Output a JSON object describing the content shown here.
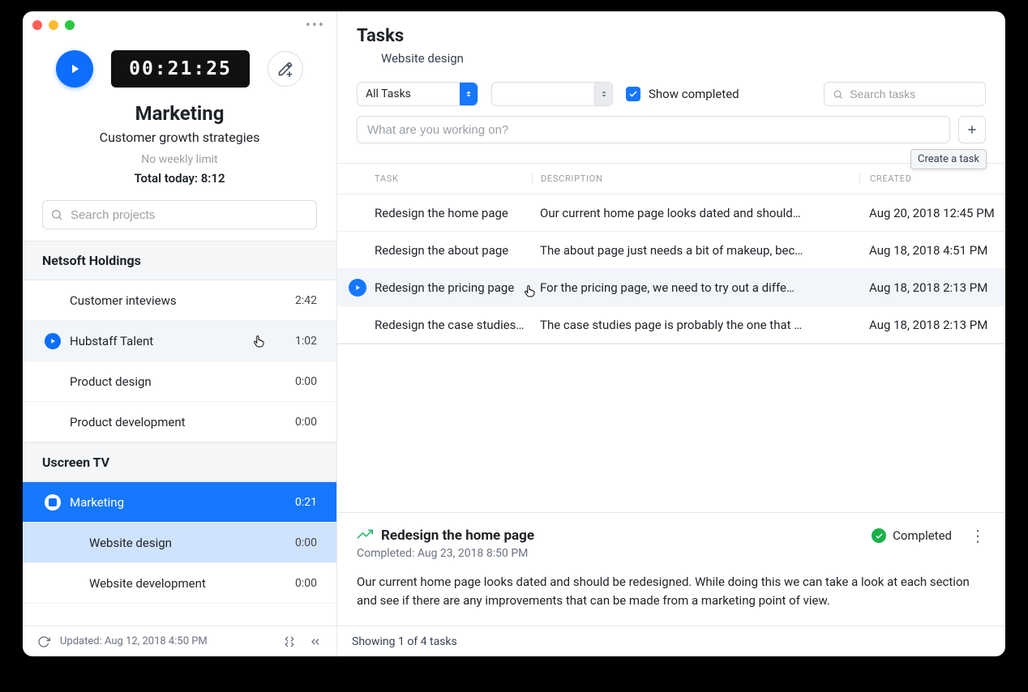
{
  "timer": {
    "elapsed": "00:21:25",
    "project_title": "Marketing",
    "project_subtitle": "Customer growth strategies",
    "weekly_limit": "No weekly limit",
    "total_today": "Total today: 8:12"
  },
  "sidebar": {
    "search_placeholder": "Search projects",
    "groups": [
      {
        "name": "Netsoft Holdings",
        "projects": [
          {
            "label": "Customer inteviews",
            "time": "2:42",
            "state": "none"
          },
          {
            "label": "Hubstaff Talent",
            "time": "1:02",
            "state": "hover_play"
          },
          {
            "label": "Product design",
            "time": "0:00",
            "state": "none"
          },
          {
            "label": "Product development",
            "time": "0:00",
            "state": "none"
          }
        ]
      },
      {
        "name": "Uscreen TV",
        "projects": [
          {
            "label": "Marketing",
            "time": "0:21",
            "state": "active_stop"
          },
          {
            "label": "Website design",
            "time": "0:00",
            "state": "sub_selected"
          },
          {
            "label": "Website development",
            "time": "0:00",
            "state": "sub"
          }
        ]
      }
    ],
    "footer": {
      "updated": "Updated: Aug 12, 2018 4:50 PM"
    }
  },
  "main": {
    "title": "Tasks",
    "subtitle": "Website design",
    "filter_select": "All Tasks",
    "show_completed_label": "Show completed",
    "search_placeholder": "Search tasks",
    "work_placeholder": "What are you working on?",
    "tooltip_create": "Create a task",
    "columns": {
      "task": "TASK",
      "desc": "DESCRIPTION",
      "created": "CREATED"
    },
    "rows": [
      {
        "task": "Redesign the home page",
        "desc": "Our current home page looks dated and should…",
        "created": "Aug 20, 2018 12:45 PM",
        "hover": false
      },
      {
        "task": "Redesign the about page",
        "desc": "The about page just needs a bit of makeup, bec…",
        "created": "Aug 18, 2018 4:51 PM",
        "hover": false
      },
      {
        "task": "Redesign the pricing page",
        "desc": "For the pricing page, we need to try out a diffe…",
        "created": "Aug 18, 2018 2:13 PM",
        "hover": true
      },
      {
        "task": "Redesign the case studies pa…",
        "desc": "The case studies page is probably the one that …",
        "created": "Aug 18, 2018 2:13 PM",
        "hover": false
      }
    ],
    "detail": {
      "title": "Redesign the home page",
      "completed_label": "Completed",
      "completed_line": "Completed: Aug 23, 2018 8:50 PM",
      "body": "Our current home page looks dated and should be redesigned. While doing this we can take a look at each section and see if there are any improvements that can be made from a marketing point of view."
    },
    "footer": "Showing 1 of 4 tasks"
  }
}
